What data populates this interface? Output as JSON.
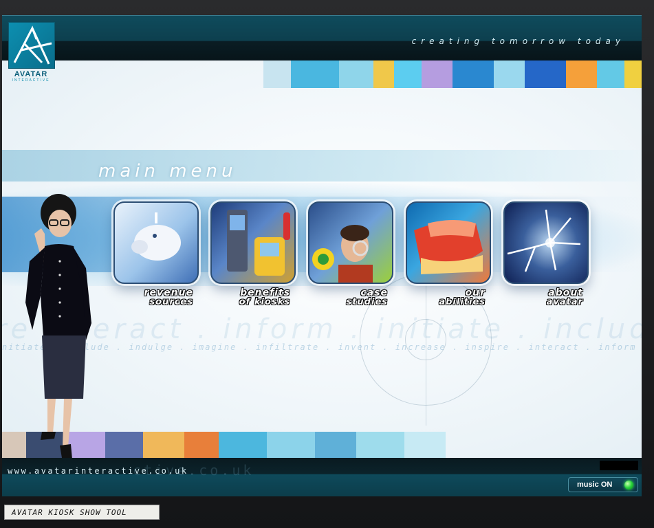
{
  "header": {
    "tagline": "creating tomorrow today",
    "logo": {
      "name": "AVATAR",
      "sub": "INTERACTIVE"
    }
  },
  "main": {
    "title": "main menu",
    "watermark_small": "nitiate . include . indulge . imagine . infiltrate . invent . increase . inspire . interact . inform . initiate . include . indulge . imagine . inf",
    "watermark_large": "re interact . inform . initiate . include",
    "menu": [
      {
        "line1": "revenue",
        "line2": "sources",
        "icon": "piggy-bank-icon"
      },
      {
        "line1": "benefits",
        "line2": "of kiosks",
        "icon": "kiosk-icon"
      },
      {
        "line1": "case",
        "line2": "studies",
        "icon": "magnifier-person-icon"
      },
      {
        "line1": "our",
        "line2": "abilities",
        "icon": "hand-icon"
      },
      {
        "line1": "about",
        "line2": "avatar",
        "icon": "cracked-glass-icon"
      }
    ]
  },
  "footer": {
    "url": "www.avatarinteractive.co.uk",
    "url_ghost": "ctive.co.uk",
    "music_label": "music ON",
    "tool_label": "AVATAR KIOSK SHOW TOOL"
  },
  "colors": {
    "bar": "#0f4b5c",
    "led": "#27d43a",
    "tile_border": "#2c4e74"
  }
}
